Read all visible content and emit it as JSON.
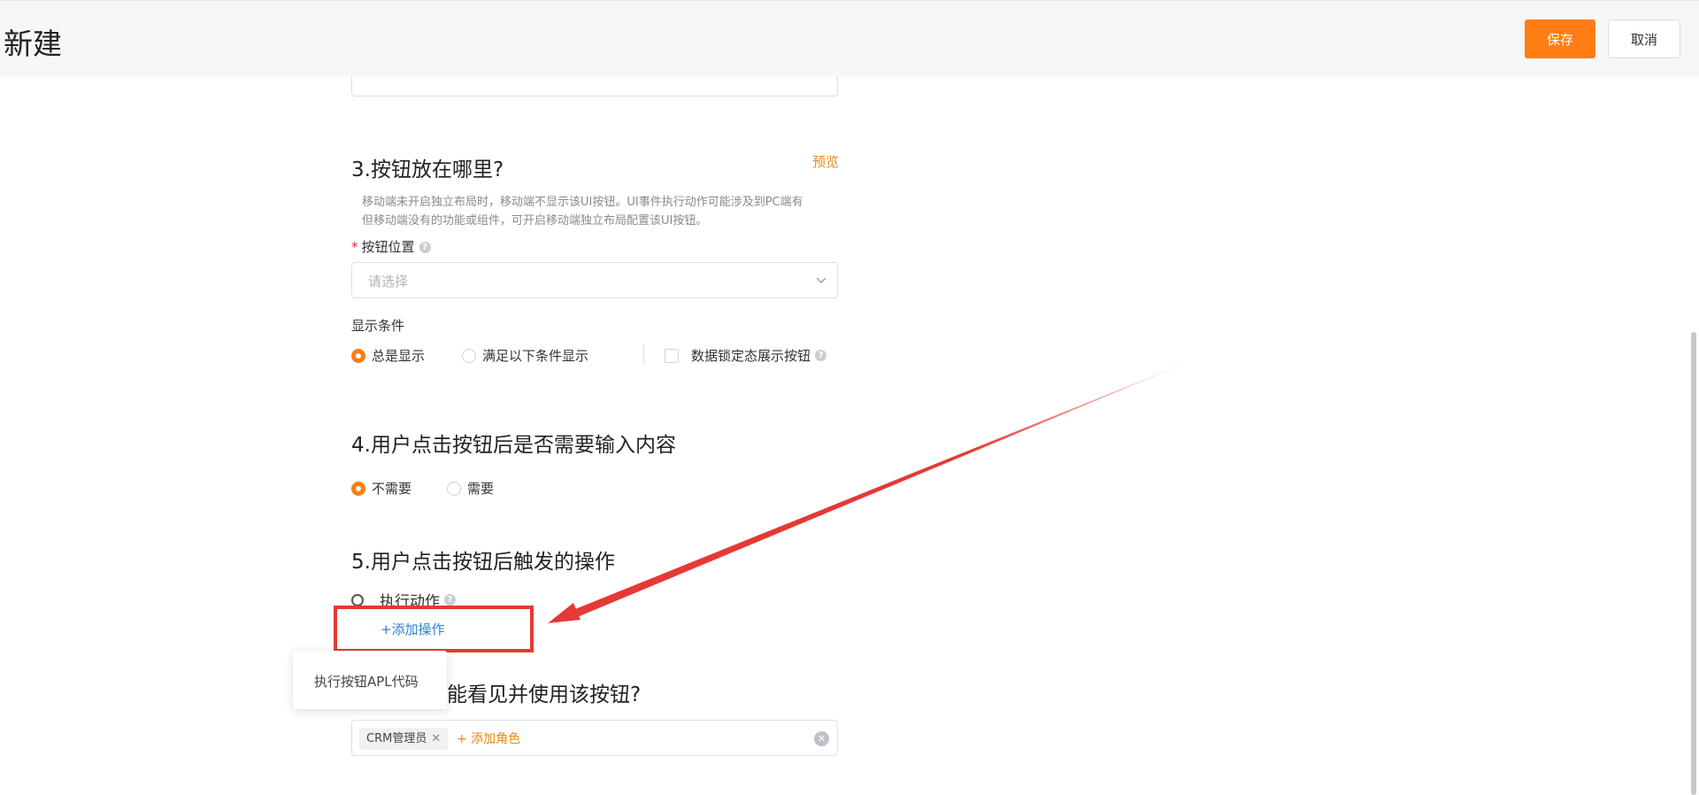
{
  "header": {
    "title": "新建",
    "save_label": "保存",
    "cancel_label": "取消"
  },
  "section3": {
    "title": "3.按钮放在哪里?",
    "preview_label": "预览",
    "hint_line1": "移动端未开启独立布局时，移动端不显示该UI按钮。UI事件执行动作可能涉及到PC端有",
    "hint_line2": "但移动端没有的功能或组件，可开启移动端独立布局配置该UI按钮。",
    "position_label": "按钮位置",
    "position_placeholder": "请选择",
    "display_condition_label": "显示条件",
    "options": {
      "always": "总是显示",
      "conditional": "满足以下条件显示",
      "locked": "数据锁定态展示按钮"
    }
  },
  "section4": {
    "title": "4.用户点击按钮后是否需要输入内容",
    "no_label": "不需要",
    "yes_label": "需要"
  },
  "section5": {
    "title": "5.用户点击按钮后触发的操作",
    "execute_label": "执行动作",
    "add_operation_label": "+添加操作"
  },
  "dropdown": {
    "item_label": "执行按钮APL代码"
  },
  "section6": {
    "title_visible": "能看见并使用该按钮?",
    "role_tag": "CRM管理员",
    "add_role_label": "+ 添加角色"
  },
  "colors": {
    "accent": "#ff7d13",
    "link": "#2d7fd6",
    "annotation": "#e53935"
  }
}
